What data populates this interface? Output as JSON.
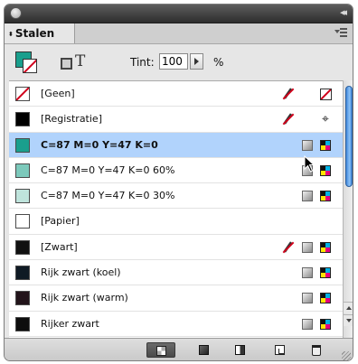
{
  "panel": {
    "tab_title": "Stalen",
    "tab_arrows_icon": "⬍"
  },
  "toolbar": {
    "tint_label": "Tint:",
    "tint_value": "100",
    "tint_unit": "%",
    "text_icon_glyph": "T"
  },
  "swatches": [
    {
      "name": "[Geen]",
      "color": "none",
      "edit_locked": true,
      "type": "none"
    },
    {
      "name": "[Registratie]",
      "color": "#000000",
      "edit_locked": true,
      "type": "registration"
    },
    {
      "name": "C=87 M=0 Y=47 K=0",
      "color": "#1a9f8d",
      "edit_locked": false,
      "type": "process",
      "selected": true
    },
    {
      "name": "C=87 M=0 Y=47 K=0 60%",
      "color": "#7cc9bb",
      "edit_locked": false,
      "type": "process"
    },
    {
      "name": "C=87 M=0 Y=47 K=0 30%",
      "color": "#bfe4dc",
      "edit_locked": false,
      "type": "process"
    },
    {
      "name": "[Papier]",
      "color": "#ffffff",
      "edit_locked": false,
      "type": "paper"
    },
    {
      "name": "[Zwart]",
      "color": "#111111",
      "edit_locked": true,
      "type": "process"
    },
    {
      "name": "Rijk zwart (koel)",
      "color": "#0f1a24",
      "edit_locked": false,
      "type": "process"
    },
    {
      "name": "Rijk zwart (warm)",
      "color": "#22141a",
      "edit_locked": false,
      "type": "process"
    },
    {
      "name": "Rijker zwart",
      "color": "#0d0d0d",
      "edit_locked": false,
      "type": "process"
    }
  ],
  "scrollbar": {
    "thumb_fraction_start": 0.0,
    "thumb_fraction_size": 0.4
  },
  "colors": {
    "selection": "#b1d3fc",
    "accent": "#1a9f8d",
    "none_red": "#d0021b"
  }
}
